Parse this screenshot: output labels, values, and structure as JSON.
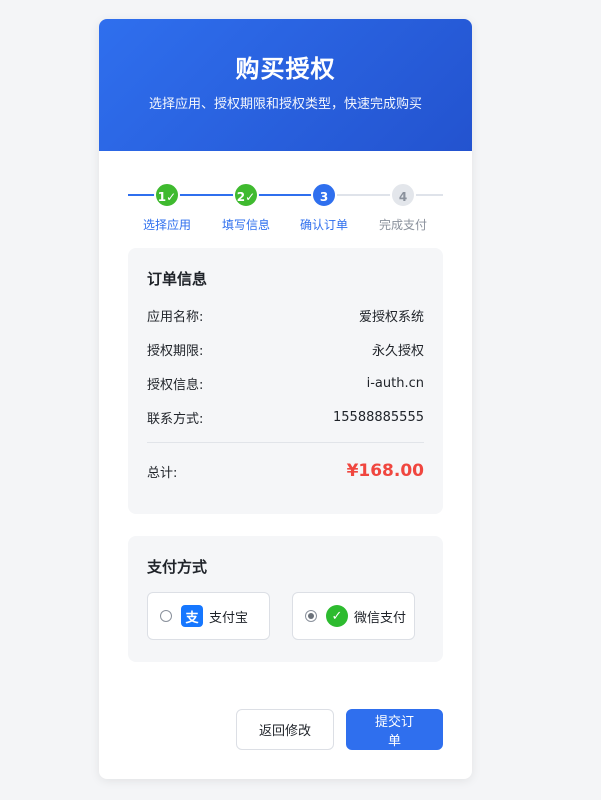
{
  "header": {
    "title": "购买授权",
    "subtitle": "选择应用、授权期限和授权类型，快速完成购买"
  },
  "steps": [
    {
      "number": "1✓",
      "label": "选择应用",
      "state": "done"
    },
    {
      "number": "2✓",
      "label": "填写信息",
      "state": "done"
    },
    {
      "number": "3",
      "label": "确认订单",
      "state": "active"
    },
    {
      "number": "4",
      "label": "完成支付",
      "state": "todo"
    }
  ],
  "order": {
    "title": "订单信息",
    "rows": [
      {
        "key": "应用名称:",
        "value": "爱授权系统"
      },
      {
        "key": "授权期限:",
        "value": "永久授权"
      },
      {
        "key": "授权信息:",
        "value": "i-auth.cn"
      },
      {
        "key": "联系方式:",
        "value": "15588885555"
      }
    ],
    "total_label": "总计:",
    "total_value": "¥168.00"
  },
  "payment": {
    "title": "支付方式",
    "methods": [
      {
        "label": "支付宝",
        "icon": "alipay-icon",
        "glyph": "支",
        "selected": false
      },
      {
        "label": "微信支付",
        "icon": "wechat-icon",
        "glyph": "✓",
        "selected": true
      }
    ]
  },
  "actions": {
    "back_label": "返回修改",
    "submit_label": "提交订单"
  },
  "colors": {
    "primary": "#2f6fee",
    "success": "#3fba2f",
    "price": "#f0463f"
  }
}
